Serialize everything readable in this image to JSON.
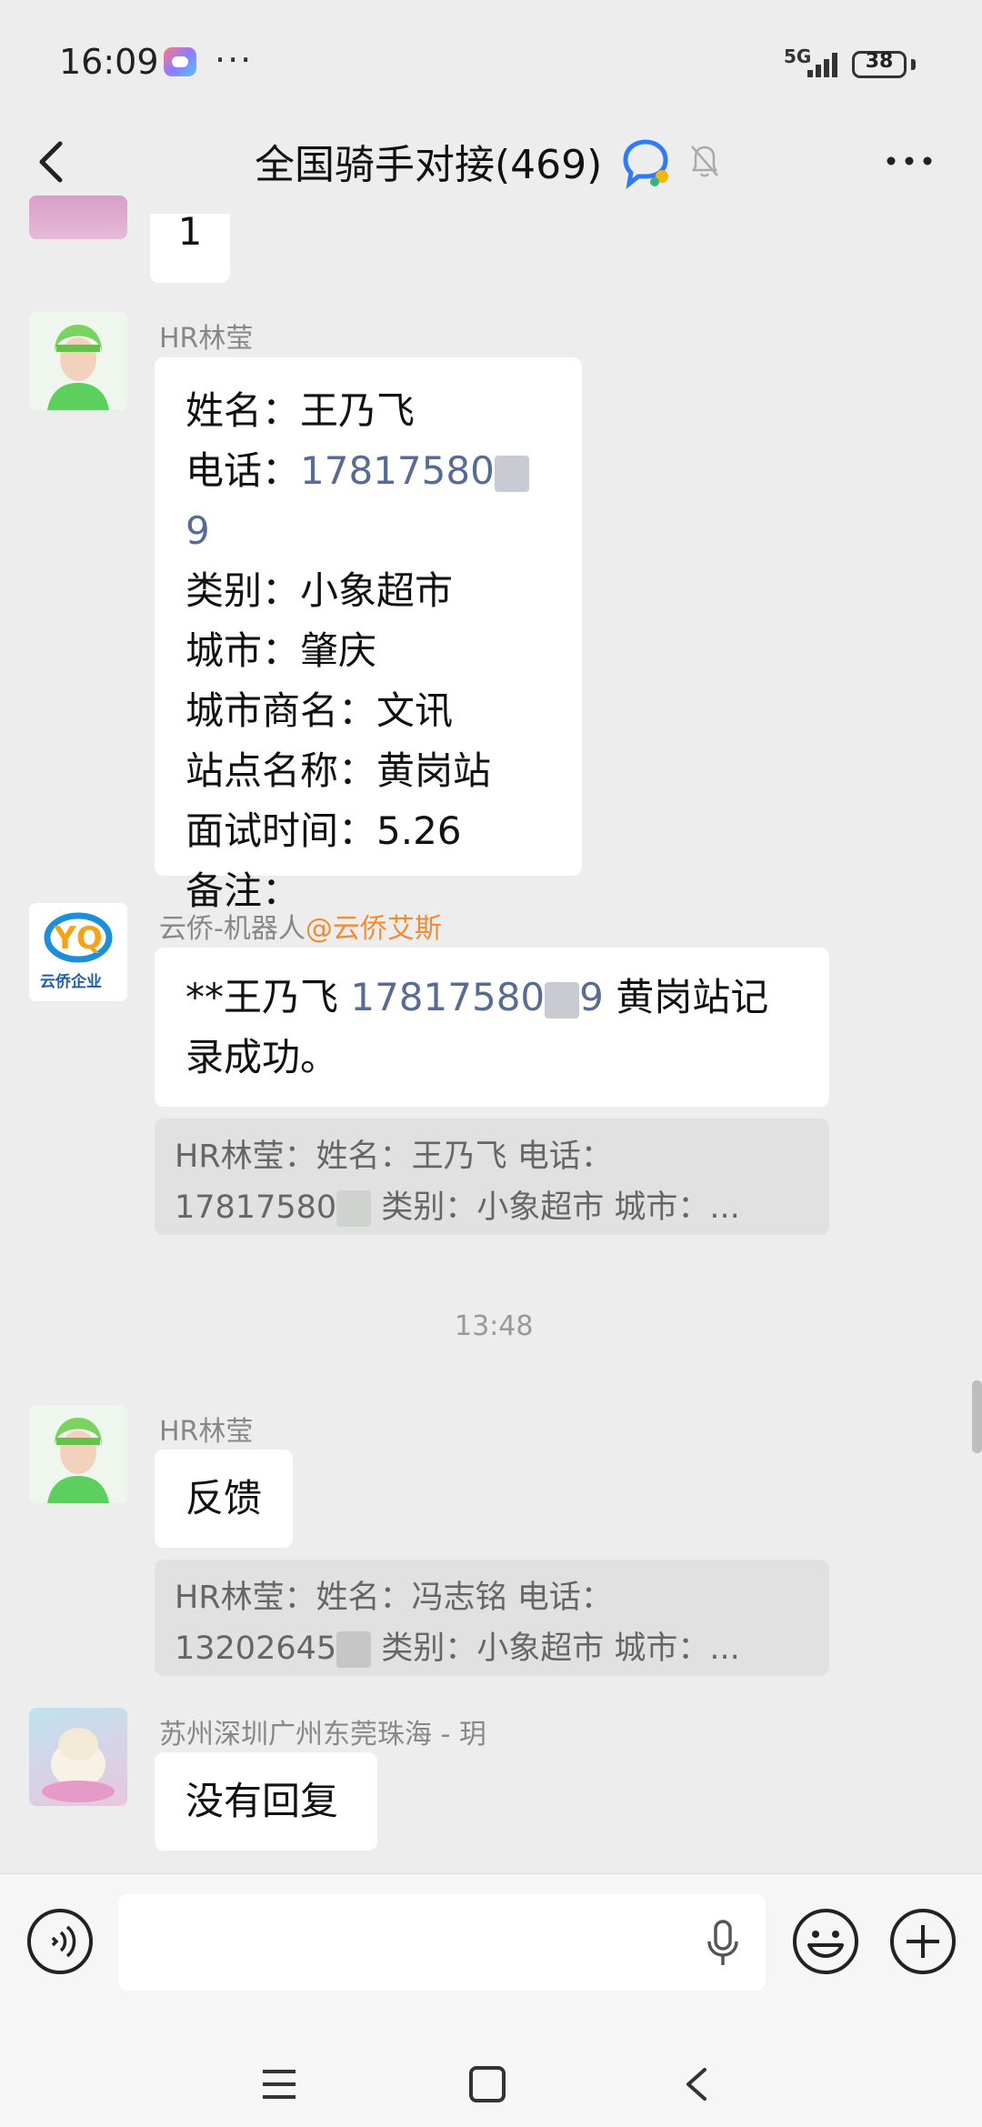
{
  "status_bar": {
    "time": "16:09",
    "dots": "···",
    "network": "5G",
    "battery": "38"
  },
  "header": {
    "title": "全国骑手对接(469)"
  },
  "messages": [
    {
      "text": "1"
    },
    {
      "sender": "HR林莹",
      "lines": [
        {
          "label": "姓名：",
          "value": "王乃飞"
        },
        {
          "label": "电话：",
          "value": "17817580",
          "tail": "9"
        },
        {
          "label": "类别：",
          "value": "小象超市"
        },
        {
          "label": "城市：",
          "value": "肇庆"
        },
        {
          "label": "城市商名：",
          "value": "文讯"
        },
        {
          "label": "站点名称：",
          "value": "黄岗站"
        },
        {
          "label": "面试时间：",
          "value": "5.26"
        },
        {
          "label": "备注：",
          "value": ""
        }
      ]
    },
    {
      "sender": "云侨-机器人",
      "mention": "@云侨艾斯",
      "avatar_text": "云侨企业",
      "line1_a": "**王乃飞 ",
      "line1_phone": "17817580",
      "line1_phone_tail": "9",
      "line1_b": " 黄岗站记",
      "line2": "录成功。",
      "quote_line1": "HR林莹：姓名：王乃飞 电话：",
      "quote_line2_a": "17817580",
      "quote_line2_b": " 类别：小象超市 城市：..."
    },
    {
      "timestamp": "13:48"
    },
    {
      "sender": "HR林莹",
      "text": "反馈",
      "quote_line1": "HR林莹：姓名：冯志铭 电话：",
      "quote_line2_a": "13202645",
      "quote_line2_b": " 类别：小象超市 城市：..."
    },
    {
      "sender": "苏州深圳广州东莞珠海 - 玥",
      "text": "没有回复"
    }
  ],
  "icons": {
    "back": "chevron-left-icon",
    "group": "group-chat-icon",
    "mute": "bell-off-icon",
    "menu": "more-icon",
    "voice": "voice-icon",
    "mic": "mic-icon",
    "emoji": "emoji-icon",
    "add": "plus-icon",
    "nav_menu": "menu-icon",
    "nav_home": "home-icon",
    "nav_back": "back-icon"
  },
  "colors": {
    "background": "#ededed",
    "link": "#576b95",
    "mention": "#f08c34"
  }
}
